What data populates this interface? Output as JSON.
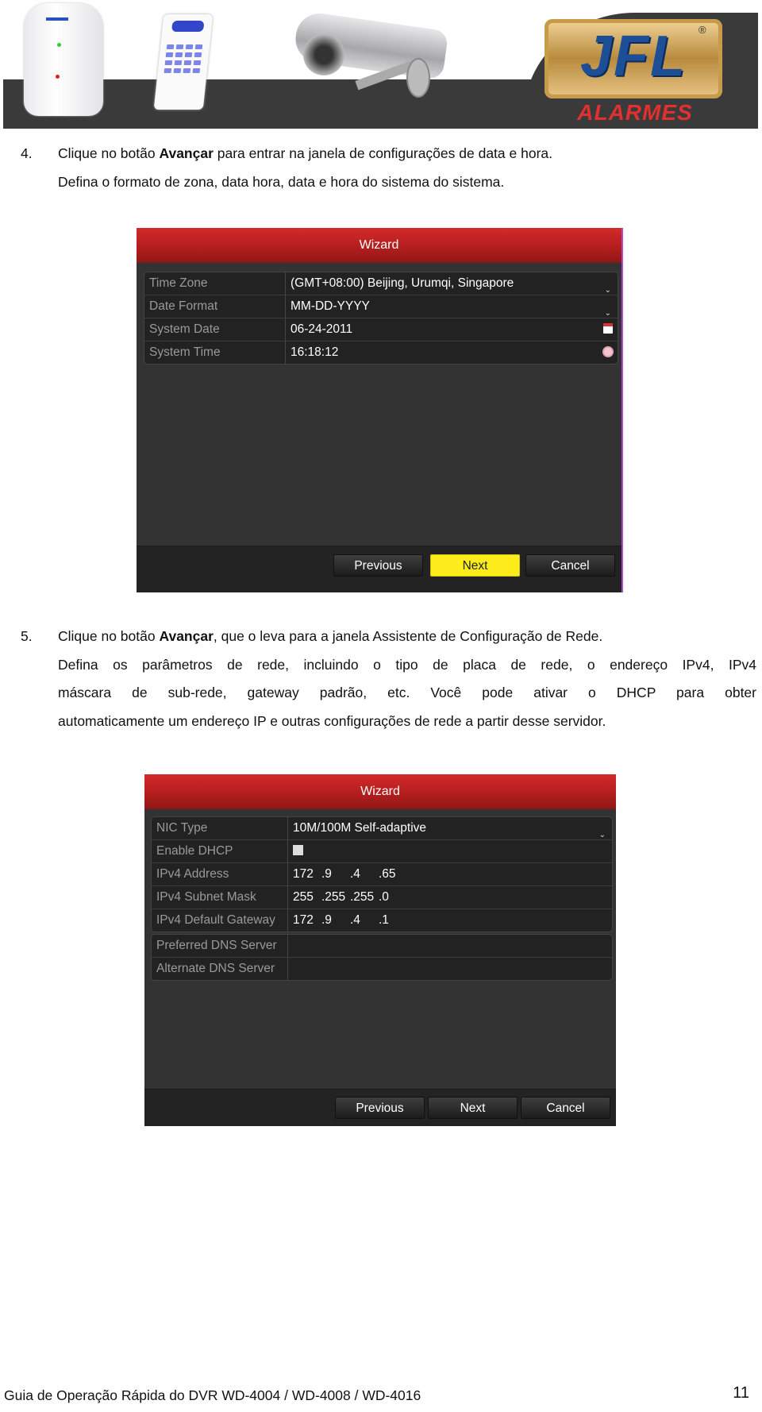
{
  "banner": {
    "brand_logo": "JFL",
    "brand_subtitle": "ALARMES",
    "registered_mark": "®",
    "keypad_screen_text": "JFL ALARMES"
  },
  "step4": {
    "number": "4.",
    "text_before": "Clique no botão ",
    "bold": "Avançar",
    "text_after": " para entrar na janela de configurações de data e hora.",
    "line2": "Defina o formato de zona, data hora, data e hora do sistema do sistema."
  },
  "wizard1": {
    "title": "Wizard",
    "rows": [
      {
        "label": "Time Zone",
        "value": "(GMT+08:00) Beijing, Urumqi, Singapore",
        "icon": "chevron-down-icon"
      },
      {
        "label": "Date Format",
        "value": "MM-DD-YYYY",
        "icon": "chevron-down-icon"
      },
      {
        "label": "System Date",
        "value": "06-24-2011",
        "icon": "calendar-icon"
      },
      {
        "label": "System Time",
        "value": "16:18:12",
        "icon": "clock-icon"
      }
    ],
    "buttons": {
      "previous": "Previous",
      "next": "Next",
      "cancel": "Cancel"
    },
    "highlight_color": "#fcec1b"
  },
  "step5": {
    "number": "5.",
    "text_before": "Clique no botão ",
    "bold": "Avançar",
    "text_after": ", que o leva para a janela Assistente de Configuração de Rede.",
    "line2": "Defina os parâmetros de rede, incluindo o tipo de placa de rede, o endereço IPv4, IPv4",
    "line3": "máscara de sub-rede, gateway padrão, etc. Você pode ativar o DHCP para obter",
    "line4": "automaticamente um endereço IP e outras configurações de rede a partir desse servidor."
  },
  "wizard2": {
    "title": "Wizard",
    "nic_label": "NIC Type",
    "nic_value": "10M/100M Self-adaptive",
    "dhcp_label": "Enable DHCP",
    "dhcp_checked": false,
    "ipv4_label": "IPv4 Address",
    "ipv4": [
      "172",
      ".9",
      ".4",
      ".65"
    ],
    "mask_label": "IPv4 Subnet Mask",
    "mask": [
      "255",
      ".255",
      ".255",
      ".0"
    ],
    "gateway_label": "IPv4 Default Gateway",
    "gateway": [
      "172",
      ".9",
      ".4",
      ".1"
    ],
    "dns1_label": "Preferred DNS Server",
    "dns1_value": "",
    "dns2_label": "Alternate DNS Server",
    "dns2_value": "",
    "buttons": {
      "previous": "Previous",
      "next": "Next",
      "cancel": "Cancel"
    }
  },
  "footer": {
    "guide_title": "Guia de Operação Rápida do DVR WD-4004 / WD-4008 / WD-4016",
    "page_number": "11"
  }
}
